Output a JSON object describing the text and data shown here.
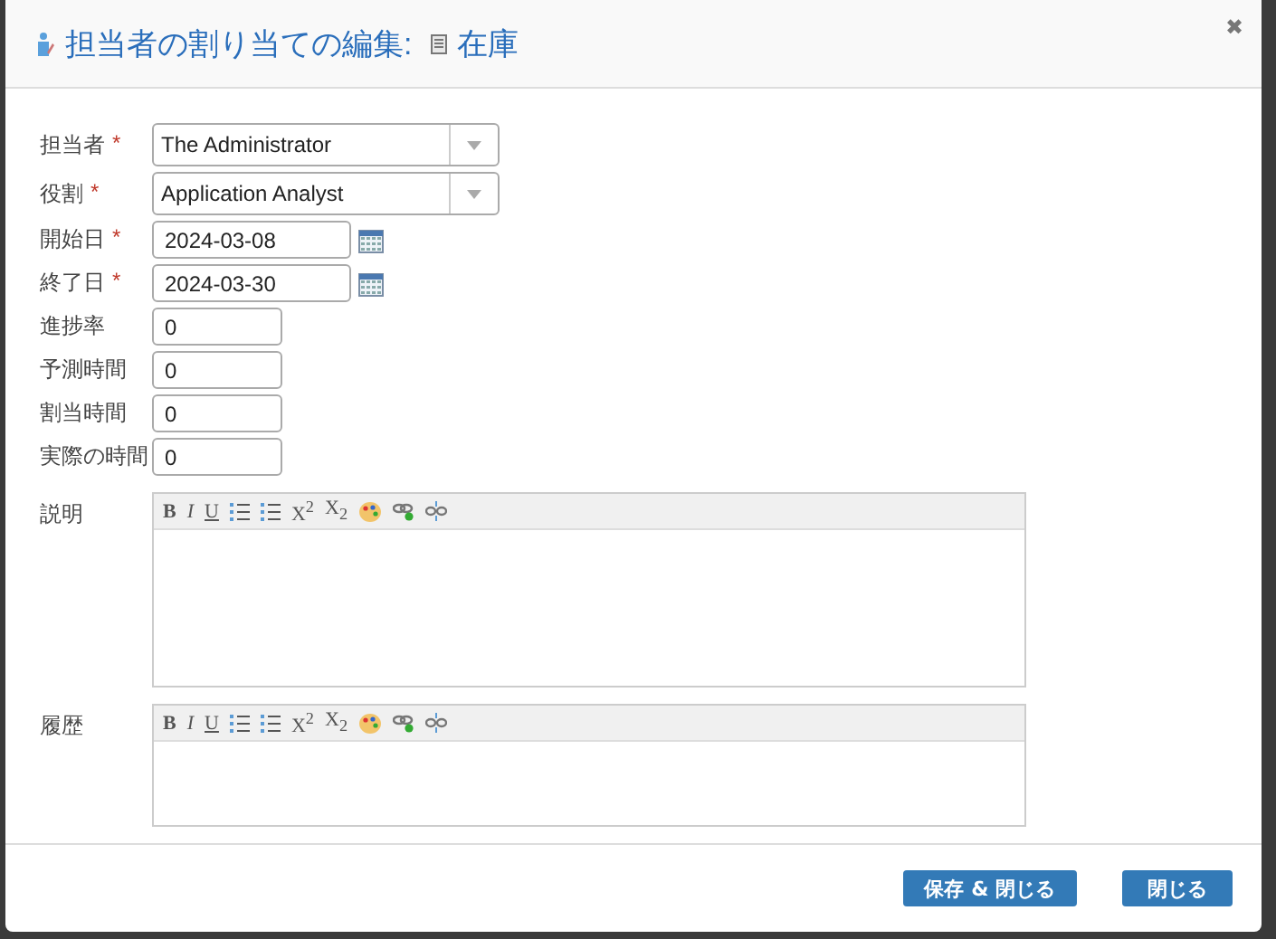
{
  "dialog": {
    "title": "担当者の割り当ての編集:",
    "subject": "在庫",
    "close": "✖"
  },
  "fields": [
    {
      "kind": "select",
      "label": "担当者",
      "required": "*",
      "value": "The Administrator"
    },
    {
      "kind": "select",
      "label": "役割",
      "required": "*",
      "value": "Application Analyst"
    },
    {
      "kind": "date",
      "label": "開始日",
      "required": "*",
      "value": "2024-03-08"
    },
    {
      "kind": "date",
      "label": "終了日",
      "required": "*",
      "value": "2024-03-30"
    },
    {
      "kind": "number",
      "label": "進捗率",
      "value": "0"
    },
    {
      "kind": "number",
      "label": "予測時間",
      "value": "0"
    },
    {
      "kind": "number",
      "label": "割当時間",
      "value": "0"
    },
    {
      "kind": "number",
      "label": "実際の時間",
      "value": "0"
    }
  ],
  "editors": [
    {
      "label": "説明",
      "toolbar": [
        "B",
        "I",
        "U",
        "X$^{2}$",
        "X$_{2}$"
      ]
    },
    {
      "label": "履歴",
      "toolbar": [
        "B",
        "I",
        "U",
        "X$^{2}$",
        "X$_{2}$"
      ]
    }
  ],
  "buttons": [
    "保存 & 閉じる",
    "閉じる"
  ]
}
